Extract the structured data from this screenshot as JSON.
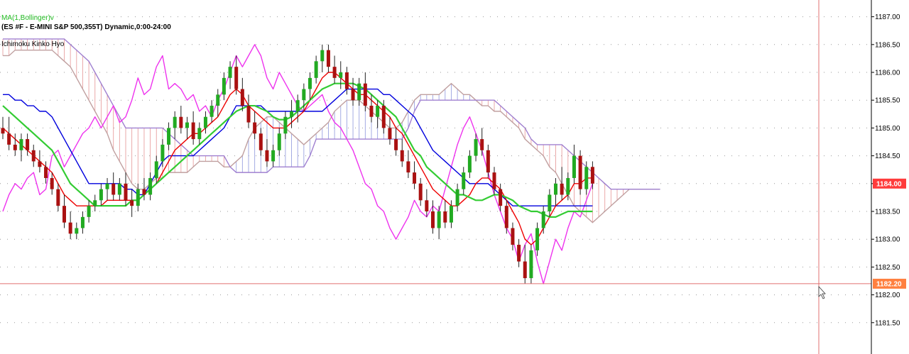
{
  "header": {
    "ma_label": "MA(1,Bollinger)v",
    "symbol_label": "(ES #F - E-MINI S&P 500,355T) Dynamic,0:00-24:00",
    "ichimoku_label": "Ichimoku Kinko Hyo"
  },
  "colors": {
    "bull": "#22aa22",
    "bear": "#aa1111",
    "tenkan": "#ee0000",
    "kijun": "#0000dd",
    "chikou": "#ee33ee",
    "ma": "#33cc33",
    "cloud_bear_line": "#c0a0a0",
    "cloud_bull_line": "#a080d0",
    "price_badge": "#ff3b3b",
    "cursor_badge": "#ff8040",
    "cursor_line": "#e07070"
  },
  "chart_data": {
    "type": "candlestick",
    "ylim": [
      1181.0,
      1187.25
    ],
    "y_ticks": [
      "1187.00",
      "1186.50",
      "1186.00",
      "1185.50",
      "1185.00",
      "1184.50",
      "1184.00",
      "1183.50",
      "1183.00",
      "1182.50",
      "1182.00",
      "1181.50"
    ],
    "last_price": "1184.00",
    "cursor_price": "1182.20",
    "candles": [
      [
        1185.0,
        1185.2,
        1184.8,
        1184.9
      ],
      [
        1184.9,
        1185.2,
        1184.6,
        1184.7
      ],
      [
        1184.7,
        1184.9,
        1184.5,
        1184.6
      ],
      [
        1184.6,
        1184.9,
        1184.4,
        1184.8
      ],
      [
        1184.8,
        1184.9,
        1184.5,
        1184.6
      ],
      [
        1184.6,
        1184.7,
        1184.3,
        1184.4
      ],
      [
        1184.4,
        1184.6,
        1184.2,
        1184.3
      ],
      [
        1184.3,
        1184.4,
        1184.0,
        1184.1
      ],
      [
        1184.1,
        1184.2,
        1183.8,
        1183.9
      ],
      [
        1183.9,
        1184.0,
        1183.5,
        1183.6
      ],
      [
        1183.6,
        1183.8,
        1183.2,
        1183.3
      ],
      [
        1183.3,
        1183.5,
        1183.0,
        1183.1
      ],
      [
        1183.1,
        1183.3,
        1183.0,
        1183.2
      ],
      [
        1183.2,
        1183.5,
        1183.1,
        1183.4
      ],
      [
        1183.4,
        1183.7,
        1183.3,
        1183.6
      ],
      [
        1183.6,
        1183.8,
        1183.5,
        1183.7
      ],
      [
        1183.7,
        1184.0,
        1183.6,
        1183.9
      ],
      [
        1183.9,
        1184.1,
        1183.7,
        1184.0
      ],
      [
        1184.0,
        1184.2,
        1183.7,
        1183.8
      ],
      [
        1183.8,
        1184.1,
        1183.7,
        1184.0
      ],
      [
        1184.0,
        1184.2,
        1183.6,
        1183.7
      ],
      [
        1183.7,
        1183.9,
        1183.4,
        1183.6
      ],
      [
        1183.6,
        1184.0,
        1183.5,
        1183.9
      ],
      [
        1183.9,
        1184.1,
        1183.7,
        1183.8
      ],
      [
        1183.8,
        1184.2,
        1183.7,
        1184.1
      ],
      [
        1184.1,
        1184.5,
        1184.0,
        1184.4
      ],
      [
        1184.4,
        1184.8,
        1184.3,
        1184.7
      ],
      [
        1184.7,
        1185.1,
        1184.6,
        1185.0
      ],
      [
        1185.0,
        1185.3,
        1184.8,
        1185.2
      ],
      [
        1185.2,
        1185.4,
        1184.9,
        1185.0
      ],
      [
        1185.0,
        1185.2,
        1184.8,
        1185.1
      ],
      [
        1185.1,
        1185.3,
        1184.7,
        1184.8
      ],
      [
        1184.8,
        1185.1,
        1184.7,
        1185.0
      ],
      [
        1185.0,
        1185.3,
        1184.9,
        1185.2
      ],
      [
        1185.2,
        1185.5,
        1185.1,
        1185.4
      ],
      [
        1185.4,
        1185.7,
        1185.2,
        1185.6
      ],
      [
        1185.6,
        1186.0,
        1185.5,
        1185.9
      ],
      [
        1185.9,
        1186.2,
        1185.7,
        1186.1
      ],
      [
        1186.1,
        1186.3,
        1185.6,
        1185.7
      ],
      [
        1185.7,
        1185.9,
        1185.3,
        1185.4
      ],
      [
        1185.4,
        1185.6,
        1185.0,
        1185.1
      ],
      [
        1185.1,
        1185.3,
        1184.8,
        1184.9
      ],
      [
        1184.9,
        1185.0,
        1184.5,
        1184.6
      ],
      [
        1184.6,
        1184.8,
        1184.3,
        1184.4
      ],
      [
        1184.4,
        1184.7,
        1184.3,
        1184.6
      ],
      [
        1184.6,
        1185.0,
        1184.5,
        1184.9
      ],
      [
        1184.9,
        1185.3,
        1184.8,
        1185.2
      ],
      [
        1185.2,
        1185.5,
        1185.0,
        1185.3
      ],
      [
        1185.3,
        1185.6,
        1185.1,
        1185.5
      ],
      [
        1185.5,
        1185.8,
        1185.3,
        1185.7
      ],
      [
        1185.7,
        1186.0,
        1185.5,
        1185.9
      ],
      [
        1185.9,
        1186.3,
        1185.8,
        1186.2
      ],
      [
        1186.2,
        1186.5,
        1186.0,
        1186.4
      ],
      [
        1186.4,
        1186.5,
        1186.0,
        1186.1
      ],
      [
        1186.1,
        1186.3,
        1185.8,
        1185.9
      ],
      [
        1185.9,
        1186.2,
        1185.7,
        1186.0
      ],
      [
        1186.0,
        1186.1,
        1185.6,
        1185.7
      ],
      [
        1185.7,
        1185.9,
        1185.4,
        1185.5
      ],
      [
        1185.5,
        1185.9,
        1185.4,
        1185.8
      ],
      [
        1185.8,
        1186.0,
        1185.3,
        1185.4
      ],
      [
        1185.4,
        1185.6,
        1185.1,
        1185.2
      ],
      [
        1185.2,
        1185.5,
        1185.0,
        1185.4
      ],
      [
        1185.4,
        1185.5,
        1184.9,
        1185.0
      ],
      [
        1185.0,
        1185.2,
        1184.7,
        1184.8
      ],
      [
        1184.8,
        1185.0,
        1184.5,
        1184.6
      ],
      [
        1184.6,
        1184.8,
        1184.3,
        1184.4
      ],
      [
        1184.4,
        1184.6,
        1184.1,
        1184.2
      ],
      [
        1184.2,
        1184.4,
        1183.9,
        1184.0
      ],
      [
        1184.0,
        1184.1,
        1183.6,
        1183.7
      ],
      [
        1183.7,
        1183.9,
        1183.4,
        1183.5
      ],
      [
        1183.5,
        1183.7,
        1183.1,
        1183.2
      ],
      [
        1183.2,
        1183.6,
        1183.0,
        1183.5
      ],
      [
        1183.5,
        1183.7,
        1183.2,
        1183.3
      ],
      [
        1183.3,
        1183.7,
        1183.2,
        1183.6
      ],
      [
        1183.6,
        1184.0,
        1183.5,
        1183.9
      ],
      [
        1183.9,
        1184.3,
        1183.8,
        1184.2
      ],
      [
        1184.2,
        1184.6,
        1184.1,
        1184.5
      ],
      [
        1184.5,
        1184.9,
        1184.4,
        1184.8
      ],
      [
        1184.8,
        1185.0,
        1184.5,
        1184.6
      ],
      [
        1184.6,
        1184.7,
        1184.1,
        1184.2
      ],
      [
        1184.2,
        1184.3,
        1183.8,
        1183.9
      ],
      [
        1183.9,
        1184.0,
        1183.5,
        1183.6
      ],
      [
        1183.6,
        1183.7,
        1183.1,
        1183.2
      ],
      [
        1183.2,
        1183.3,
        1182.8,
        1182.9
      ],
      [
        1182.9,
        1183.0,
        1182.5,
        1182.6
      ],
      [
        1182.6,
        1182.9,
        1182.2,
        1182.3
      ],
      [
        1182.3,
        1182.9,
        1182.2,
        1182.8
      ],
      [
        1182.8,
        1183.3,
        1182.7,
        1183.2
      ],
      [
        1183.2,
        1183.6,
        1183.1,
        1183.5
      ],
      [
        1183.5,
        1183.9,
        1183.4,
        1183.8
      ],
      [
        1183.8,
        1184.1,
        1183.6,
        1184.0
      ],
      [
        1184.0,
        1184.3,
        1183.7,
        1183.8
      ],
      [
        1183.8,
        1184.2,
        1183.7,
        1184.1
      ],
      [
        1184.1,
        1184.7,
        1184.0,
        1184.5
      ],
      [
        1184.5,
        1184.6,
        1183.8,
        1183.9
      ],
      [
        1183.9,
        1184.4,
        1183.8,
        1184.3
      ],
      [
        1184.3,
        1184.4,
        1183.9,
        1184.0
      ]
    ],
    "tenkan": [
      1185.0,
      1184.9,
      1184.8,
      1184.7,
      1184.6,
      1184.5,
      1184.4,
      1184.3,
      1184.2,
      1184.0,
      1183.8,
      1183.7,
      1183.6,
      1183.6,
      1183.6,
      1183.6,
      1183.6,
      1183.7,
      1183.7,
      1183.7,
      1183.7,
      1183.7,
      1183.7,
      1183.8,
      1183.9,
      1184.0,
      1184.2,
      1184.4,
      1184.6,
      1184.7,
      1184.8,
      1184.9,
      1184.9,
      1185.0,
      1185.1,
      1185.2,
      1185.4,
      1185.6,
      1185.7,
      1185.6,
      1185.4,
      1185.3,
      1185.2,
      1185.1,
      1185.0,
      1185.0,
      1185.0,
      1185.1,
      1185.2,
      1185.3,
      1185.5,
      1185.7,
      1185.9,
      1186.0,
      1186.0,
      1185.9,
      1185.8,
      1185.7,
      1185.6,
      1185.6,
      1185.5,
      1185.4,
      1185.3,
      1185.2,
      1185.0,
      1184.9,
      1184.7,
      1184.5,
      1184.3,
      1184.1,
      1183.9,
      1183.8,
      1183.7,
      1183.6,
      1183.6,
      1183.7,
      1183.8,
      1184.0,
      1184.1,
      1184.1,
      1184.0,
      1183.9,
      1183.7,
      1183.5,
      1183.3,
      1183.0,
      1182.9,
      1183.0,
      1183.2,
      1183.4,
      1183.6,
      1183.7,
      1183.8,
      1184.0,
      1184.0,
      1184.1,
      1184.1
    ],
    "kijun": [
      1185.6,
      1185.6,
      1185.5,
      1185.5,
      1185.4,
      1185.4,
      1185.3,
      1185.3,
      1185.2,
      1185.0,
      1184.8,
      1184.6,
      1184.4,
      1184.2,
      1184.0,
      1184.0,
      1184.0,
      1184.0,
      1184.0,
      1184.0,
      1183.9,
      1183.9,
      1183.8,
      1183.8,
      1184.0,
      1184.2,
      1184.4,
      1184.5,
      1184.5,
      1184.5,
      1184.5,
      1184.5,
      1184.6,
      1184.7,
      1184.8,
      1184.9,
      1185.0,
      1185.2,
      1185.4,
      1185.4,
      1185.4,
      1185.4,
      1185.4,
      1185.3,
      1185.3,
      1185.3,
      1185.3,
      1185.3,
      1185.3,
      1185.3,
      1185.3,
      1185.3,
      1185.3,
      1185.4,
      1185.5,
      1185.6,
      1185.7,
      1185.7,
      1185.7,
      1185.7,
      1185.7,
      1185.7,
      1185.6,
      1185.6,
      1185.5,
      1185.4,
      1185.3,
      1185.2,
      1185.0,
      1184.8,
      1184.6,
      1184.5,
      1184.4,
      1184.3,
      1184.2,
      1184.1,
      1184.0,
      1184.0,
      1184.0,
      1184.0,
      1183.9,
      1183.8,
      1183.7,
      1183.6,
      1183.6,
      1183.6,
      1183.6,
      1183.6,
      1183.6,
      1183.6,
      1183.6,
      1183.6,
      1183.6,
      1183.6,
      1183.6,
      1183.6,
      1183.6
    ],
    "ma": [
      1185.4,
      1185.3,
      1185.2,
      1185.1,
      1185.0,
      1184.9,
      1184.8,
      1184.7,
      1184.6,
      1184.4,
      1184.2,
      1184.0,
      1183.9,
      1183.8,
      1183.7,
      1183.6,
      1183.6,
      1183.6,
      1183.6,
      1183.6,
      1183.6,
      1183.7,
      1183.7,
      1183.8,
      1183.9,
      1184.0,
      1184.1,
      1184.2,
      1184.3,
      1184.4,
      1184.5,
      1184.6,
      1184.7,
      1184.8,
      1184.9,
      1185.0,
      1185.1,
      1185.2,
      1185.3,
      1185.35,
      1185.4,
      1185.4,
      1185.35,
      1185.3,
      1185.2,
      1185.15,
      1185.15,
      1185.2,
      1185.3,
      1185.4,
      1185.5,
      1185.6,
      1185.7,
      1185.75,
      1185.8,
      1185.8,
      1185.8,
      1185.8,
      1185.75,
      1185.7,
      1185.6,
      1185.5,
      1185.4,
      1185.3,
      1185.2,
      1185.0,
      1184.8,
      1184.6,
      1184.5,
      1184.3,
      1184.2,
      1184.1,
      1184.0,
      1183.9,
      1183.8,
      1183.8,
      1183.75,
      1183.7,
      1183.7,
      1183.75,
      1183.8,
      1183.8,
      1183.75,
      1183.7,
      1183.6,
      1183.55,
      1183.5,
      1183.5,
      1183.45,
      1183.4,
      1183.4,
      1183.45,
      1183.5,
      1183.5,
      1183.5,
      1183.5,
      1183.5
    ],
    "chikou": [
      1183.5,
      1183.8,
      1184.0,
      1183.9,
      1184.1,
      1184.2,
      1183.8,
      1183.9,
      1184.5,
      1184.6,
      1184.3,
      1184.5,
      1184.7,
      1184.9,
      1185.0,
      1185.2,
      1185.0,
      1185.2,
      1185.4,
      1185.1,
      1185.2,
      1185.5,
      1185.9,
      1185.6,
      1185.7,
      1186.1,
      1186.3,
      1185.7,
      1185.8,
      1185.7,
      1185.5,
      1185.6,
      1185.3,
      1185.4,
      1185.2,
      1185.5,
      1185.7,
      1186.0,
      1186.3,
      1186.1,
      1186.3,
      1186.5,
      1186.3,
      1185.9,
      1185.7,
      1186.0,
      1185.8,
      1185.6,
      1185.4,
      1185.3,
      1185.4,
      1185.5,
      1185.6,
      1185.3,
      1185.1,
      1185.0,
      1184.8,
      1184.6,
      1184.3,
      1184.0,
      1183.9,
      1183.6,
      1183.5,
      1183.2,
      1183.0,
      1183.2,
      1183.4,
      1183.7,
      1183.5,
      1183.4,
      1183.6,
      1183.5,
      1183.9,
      1184.3,
      1184.7,
      1185.0,
      1185.2,
      1184.9,
      1184.6,
      1184.2,
      1183.8,
      1183.5,
      1183.2,
      1183.0,
      1182.6,
      1182.9,
      1183.1,
      1182.6,
      1182.2,
      1182.6,
      1183.0,
      1182.8,
      1183.2,
      1183.5,
      1183.4,
      1183.7,
      1184.0
    ],
    "senkou_a": [
      1186.3,
      1186.3,
      1186.4,
      1186.4,
      1186.4,
      1186.4,
      1186.4,
      1186.4,
      1186.4,
      1186.3,
      1186.2,
      1186.1,
      1185.9,
      1185.7,
      1185.5,
      1185.3,
      1185.1,
      1184.9,
      1184.6,
      1184.4,
      1184.2,
      1184.0,
      1183.9,
      1183.9,
      1184.0,
      1184.1,
      1184.1,
      1184.2,
      1184.2,
      1184.2,
      1184.2,
      1184.3,
      1184.4,
      1184.4,
      1184.4,
      1184.4,
      1184.3,
      1184.3,
      1184.4,
      1184.5,
      1184.8,
      1185.0,
      1185.1,
      1185.2,
      1185.2,
      1185.1,
      1185.0,
      1184.9,
      1184.8,
      1184.7,
      1184.8,
      1184.9,
      1185.0,
      1185.1,
      1185.3,
      1185.4,
      1185.5,
      1185.5,
      1185.5,
      1185.4,
      1185.3,
      1185.2,
      1185.1,
      1185.0,
      1185.0,
      1185.1,
      1185.3,
      1185.5,
      1185.6,
      1185.6,
      1185.6,
      1185.6,
      1185.7,
      1185.8,
      1185.7,
      1185.6,
      1185.6,
      1185.5,
      1185.4,
      1185.4,
      1185.3,
      1185.3,
      1185.2,
      1185.1,
      1185.0,
      1184.8,
      1184.7,
      1184.6,
      1184.5,
      1184.3,
      1184.2,
      1184.0,
      1183.8,
      1183.6,
      1183.5,
      1183.4,
      1183.3,
      1183.4,
      1183.5,
      1183.6,
      1183.7,
      1183.8,
      1183.9,
      1183.9,
      1183.9,
      1183.9,
      1183.9,
      1183.9
    ],
    "senkou_b": [
      1186.6,
      1186.6,
      1186.6,
      1186.6,
      1186.6,
      1186.6,
      1186.6,
      1186.6,
      1186.6,
      1186.6,
      1186.6,
      1186.5,
      1186.4,
      1186.3,
      1186.2,
      1186.0,
      1185.8,
      1185.6,
      1185.4,
      1185.2,
      1185.0,
      1185.0,
      1185.0,
      1185.0,
      1185.0,
      1185.0,
      1185.0,
      1184.9,
      1184.8,
      1184.7,
      1184.6,
      1184.5,
      1184.5,
      1184.5,
      1184.5,
      1184.5,
      1184.5,
      1184.3,
      1184.2,
      1184.2,
      1184.2,
      1184.2,
      1184.2,
      1184.2,
      1184.3,
      1184.3,
      1184.3,
      1184.3,
      1184.3,
      1184.3,
      1184.5,
      1184.8,
      1184.8,
      1184.8,
      1184.8,
      1184.8,
      1184.8,
      1184.8,
      1184.8,
      1184.8,
      1184.8,
      1184.8,
      1184.8,
      1184.8,
      1184.8,
      1184.8,
      1185.0,
      1185.3,
      1185.5,
      1185.5,
      1185.5,
      1185.5,
      1185.5,
      1185.5,
      1185.5,
      1185.5,
      1185.5,
      1185.5,
      1185.5,
      1185.5,
      1185.5,
      1185.4,
      1185.3,
      1185.2,
      1185.1,
      1185.0,
      1184.8,
      1184.7,
      1184.7,
      1184.7,
      1184.7,
      1184.7,
      1184.6,
      1184.5,
      1184.4,
      1184.3,
      1184.2,
      1184.1,
      1184.0,
      1183.9,
      1183.9,
      1183.9,
      1183.9,
      1183.9,
      1183.9,
      1183.9,
      1183.9,
      1183.9
    ]
  }
}
